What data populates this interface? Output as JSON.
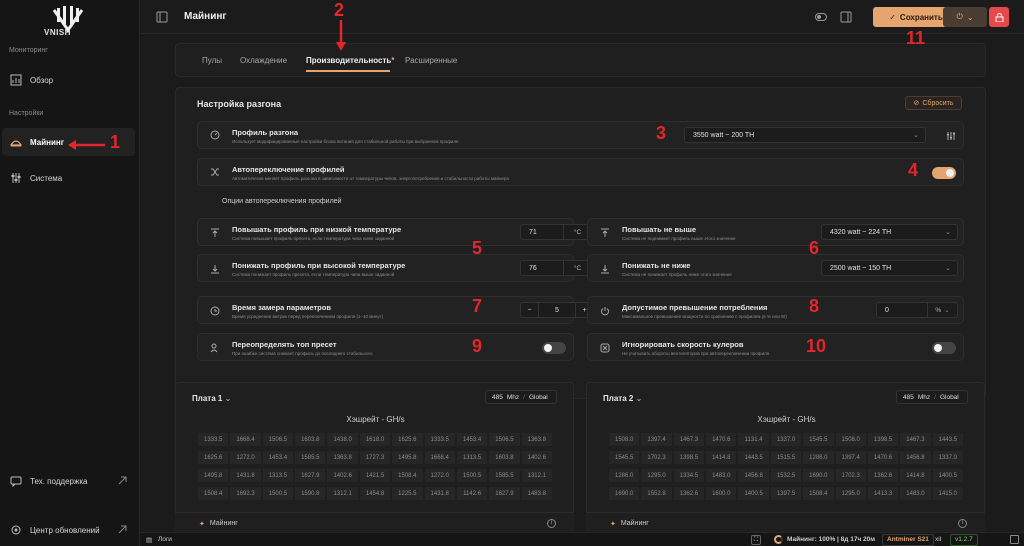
{
  "brand": "VNISH",
  "sidebar": {
    "monitoring_label": "Мониторинг",
    "overview": "Обзор",
    "settings_label": "Настройки",
    "mining": "Майнинг",
    "system": "Система",
    "support": "Тех. поддержка",
    "updates": "Центр обновлений"
  },
  "topbar": {
    "title": "Майнинг",
    "save": "Сохранить"
  },
  "tabs": [
    {
      "label": "Пулы"
    },
    {
      "label": "Охлаждение"
    },
    {
      "label": "Производительность"
    },
    {
      "label": "Расширенные"
    }
  ],
  "tabs_modified_mark": "*",
  "overclock": {
    "title": "Настройка разгона",
    "reset": "Сбросить",
    "profile": {
      "title": "Профиль разгона",
      "sub": "Использует модифицированные настройки блока питания для стабильной работы при выбранном профиле",
      "value": "3550 watt ~ 200 TH"
    },
    "autoswitch": {
      "title": "Автопереключение профилей",
      "sub": "Автоматически меняет профиль разгона в зависимости от температуры чипов, энергопотребления и стабильности работы майнера",
      "on": true
    },
    "options_title": "Опции автопереключения профилей",
    "raise_low": {
      "title": "Повышать профиль при низкой температуре",
      "sub": "Система повышает профиль пресета, если температура чипа ниже заданной",
      "value": "71",
      "unit": "°C"
    },
    "lower_high": {
      "title": "Понижать профиль при высокой температуре",
      "sub": "Система понижает профиль пресета, если температура чипа выше заданной",
      "value": "76",
      "unit": "°C"
    },
    "measure_time": {
      "title": "Время замера параметров",
      "sub": "Время усреднения метрик перед переключением профиля (1–10 минут)",
      "value": "5",
      "minus": "−",
      "plus": "+"
    },
    "override_top": {
      "title": "Переопределять топ пресет",
      "sub": "При ошибке система снижает профиль до последнего стабильного",
      "on": false
    },
    "raise_max": {
      "title": "Повышать не выше",
      "sub": "Система не поднимает профиль выше этого значения",
      "value": "4320 watt ~ 224 TH"
    },
    "lower_min": {
      "title": "Понижать не ниже",
      "sub": "Система не понижает профиль ниже этого значения",
      "value": "2500 watt ~ 150 TH"
    },
    "overconsumption": {
      "title": "Допустимое превышение потребления",
      "sub": "Максимальное превышение мощности по сравнению с профилем (в % или W)",
      "value": "0",
      "unit": "%"
    },
    "ignore_fans": {
      "title": "Игнорировать скорость кулеров",
      "sub": "Не учитывать обороты вентиляторов при автопереключении профиля",
      "on": false
    }
  },
  "boards": [
    {
      "title": "Плата 1",
      "freq": "485",
      "unit": "Mhz",
      "mode": "Global",
      "hash_title": "Хэшрейт - GH/s",
      "footer": "Майнинг",
      "values": [
        [
          "1333.5",
          "1668.4",
          "1506.5",
          "1603.8",
          "1438.0",
          "1618.0",
          "1625.6",
          "1333.5",
          "1453.4",
          "1506.5",
          "1363.8",
          "1438.0"
        ],
        [
          "1625.6",
          "1272.0",
          "1453.4",
          "1585.5",
          "1363.8",
          "1727.3",
          "1495.8",
          "1668.4",
          "1313.5",
          "1603.8",
          "1402.6",
          "1618.0"
        ],
        [
          "1495.8",
          "1431.8",
          "1313.5",
          "1627.9",
          "1402.6",
          "1421.5",
          "1508.4",
          "1272.0",
          "1500.5",
          "1585.5",
          "1312.1",
          "1727.3"
        ],
        [
          "1508.4",
          "1692.3",
          "1500.5",
          "1590.8",
          "1312.1",
          "1454.8",
          "1225.5",
          "1431.8",
          "1142.6",
          "1627.9",
          "1483.8",
          "1421.5"
        ]
      ]
    },
    {
      "title": "Плата 2",
      "freq": "485",
      "unit": "Mhz",
      "mode": "Global",
      "hash_title": "Хэшрейт - GH/s",
      "footer": "Майнинг",
      "values": [
        [
          "1508.0",
          "1397.4",
          "1467.3",
          "1470.6",
          "1131.4",
          "1337.0",
          "1545.5",
          "1508.0",
          "1398.5",
          "1467.3",
          "1443.5",
          "1131.4"
        ],
        [
          "1545.5",
          "1702.3",
          "1398.5",
          "1414.8",
          "1443.5",
          "1515.5",
          "1286.0",
          "1397.4",
          "1470.6",
          "1456.8",
          "1337.0"
        ],
        [
          "1286.0",
          "1295.0",
          "1334.5",
          "1483.0",
          "1456.8",
          "1532.5",
          "1690.0",
          "1702.3",
          "1362.6",
          "1414.8",
          "1400.5",
          "1515.5"
        ],
        [
          "1690.0",
          "1552.8",
          "1362.6",
          "1600.0",
          "1400.5",
          "1397.5",
          "1508.4",
          "1295.0",
          "1413.3",
          "1483.0",
          "1415.0",
          "1532.5"
        ]
      ]
    }
  ],
  "statusbar": {
    "logs": "Логи",
    "status": "Майнинг: 100% | 8д 17ч 20м",
    "model": "Antminer S21",
    "fw": "v1.2.7"
  },
  "markers": [
    "1",
    "2",
    "3",
    "4",
    "5",
    "6",
    "7",
    "8",
    "9",
    "10",
    "11"
  ],
  "colors": {
    "accent": "#e6a56f",
    "marker": "#e3262b",
    "bg": "#1b1b1b"
  }
}
